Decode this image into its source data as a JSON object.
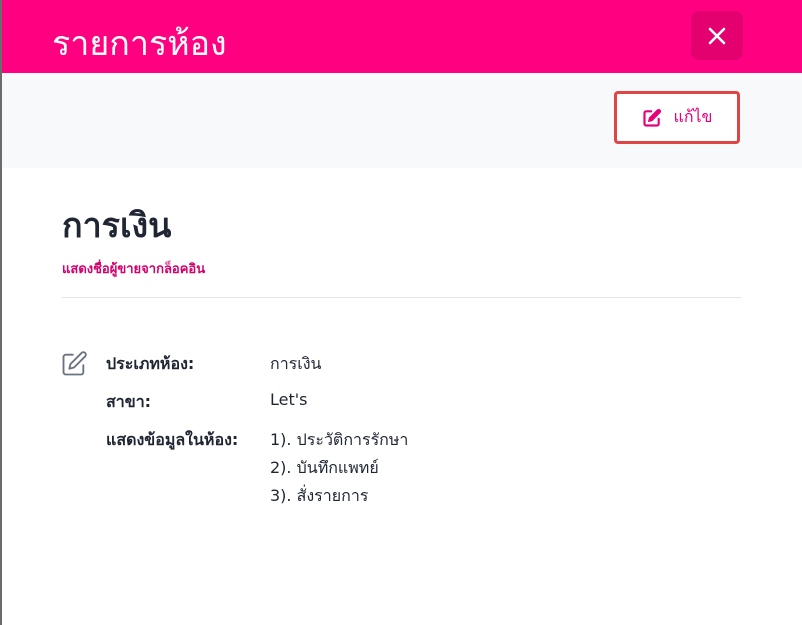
{
  "modal": {
    "title": "รายการห้อง",
    "close_icon": "close-icon"
  },
  "toolbar": {
    "edit_label": "แก้ไข",
    "edit_icon": "edit-icon"
  },
  "room": {
    "name": "การเงิน",
    "subtitle": "แสดงชื่อผู้ขายจากล็อคอิน"
  },
  "details": {
    "icon": "edit-icon",
    "type_label": "ประเภทห้อง:",
    "type_value": "การเงิน",
    "branch_label": "สาขา:",
    "branch_value": "Let's",
    "display_label": "แสดงข้อมูลในห้อง:",
    "display_items": [
      "1). ประวัติการรักษา",
      "2). บันทึกแพทย์",
      "3). สั่งรายการ"
    ]
  },
  "colors": {
    "header": "#ff0080",
    "close_button": "#e3006f",
    "accent_text": "#e6007a",
    "focus_border": "#e04545"
  }
}
